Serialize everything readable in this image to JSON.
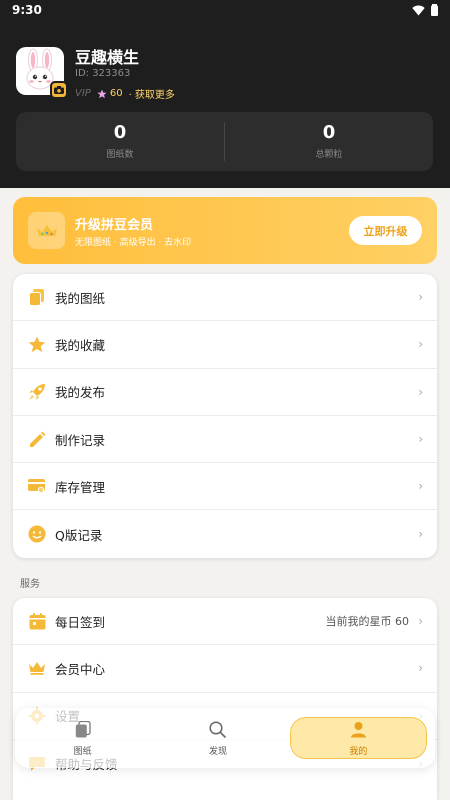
{
  "status_bar": {
    "time": "9:30"
  },
  "profile": {
    "name": "豆趣横生",
    "id_text": "ID: 323363",
    "vip_label": "VIP",
    "coins": "60",
    "get_more": "· 获取更多"
  },
  "stats": [
    {
      "value": "0",
      "label": "图纸数"
    },
    {
      "value": "0",
      "label": "总颗粒"
    }
  ],
  "banner": {
    "title": "升级拼豆会员",
    "subtitle": "无限图纸 · 高级导出 · 去水印",
    "button": "立即升级"
  },
  "menu": [
    {
      "label": "我的图纸",
      "icon": "drawings-icon"
    },
    {
      "label": "我的收藏",
      "icon": "star-icon"
    },
    {
      "label": "我的发布",
      "icon": "rocket-icon"
    },
    {
      "label": "制作记录",
      "icon": "pencil-icon"
    },
    {
      "label": "库存管理",
      "icon": "inventory-icon"
    },
    {
      "label": "Q版记录",
      "icon": "smile-icon"
    }
  ],
  "services_title": "服务",
  "services": [
    {
      "label": "每日签到",
      "right": "当前我的星币 60",
      "icon": "calendar-icon"
    },
    {
      "label": "会员中心",
      "icon": "crown-icon"
    },
    {
      "label": "设置",
      "icon": "gear-icon"
    },
    {
      "label": "帮助与反馈",
      "icon": "feedback-icon"
    }
  ],
  "nav": [
    {
      "label": "图纸",
      "icon": "drawings-icon"
    },
    {
      "label": "发现",
      "icon": "search-icon"
    },
    {
      "label": "我的",
      "icon": "person-icon"
    }
  ],
  "colors": {
    "accent": "#f5b73a",
    "header_bg": "#1e1e1e"
  }
}
